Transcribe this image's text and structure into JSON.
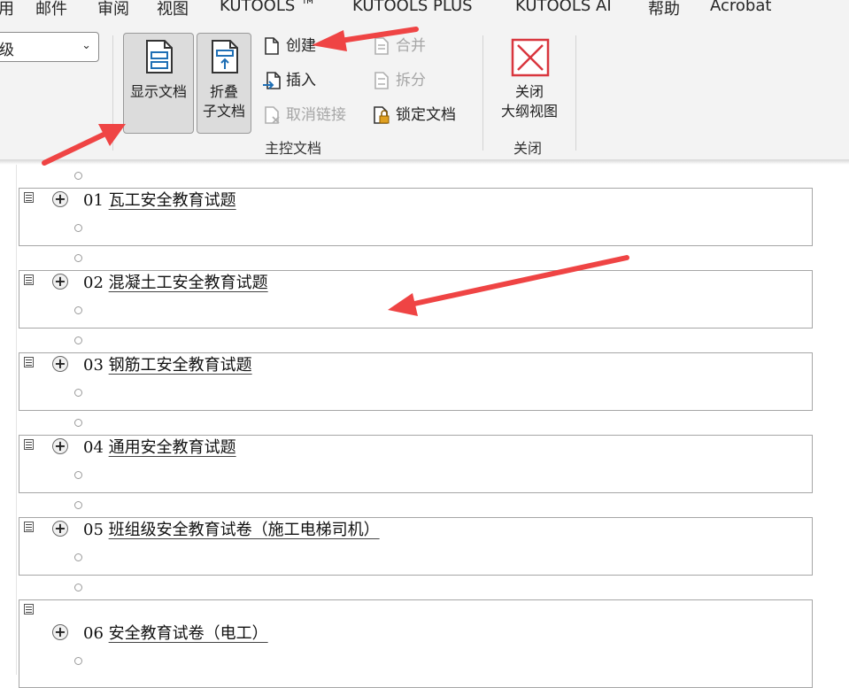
{
  "menu": [
    "用",
    "邮件",
    "审阅",
    "视图",
    "KUTOOLS ™",
    "KUTOOLS PLUS",
    "KUTOOLS AI",
    "帮助",
    "Acrobat"
  ],
  "ribbon": {
    "level_value": "级",
    "show_document_label": "显示文档",
    "collapse_label_line1": "折叠",
    "collapse_label_line2": "子文档",
    "create_label": "创建",
    "insert_label": "插入",
    "unlink_label": "取消链接",
    "merge_label": "合并",
    "split_label": "拆分",
    "lock_label": "锁定文档",
    "master_group_label": "主控文档",
    "close_line1": "关闭",
    "close_line2": "大纲视图",
    "close_group_label": "关闭",
    "accent_red": "#d9363e"
  },
  "subdocs": [
    {
      "num": "01",
      "title": "瓦工安全教育试题"
    },
    {
      "num": "02",
      "title": "混凝土工安全教育试题"
    },
    {
      "num": "03",
      "title": "钢筋工安全教育试题"
    },
    {
      "num": "04",
      "title": "通用安全教育试题"
    },
    {
      "num": "05",
      "title": "班组级安全教育试卷（施工电梯司机）"
    },
    {
      "num": "06",
      "title": "安全教育试卷（电工）"
    }
  ]
}
